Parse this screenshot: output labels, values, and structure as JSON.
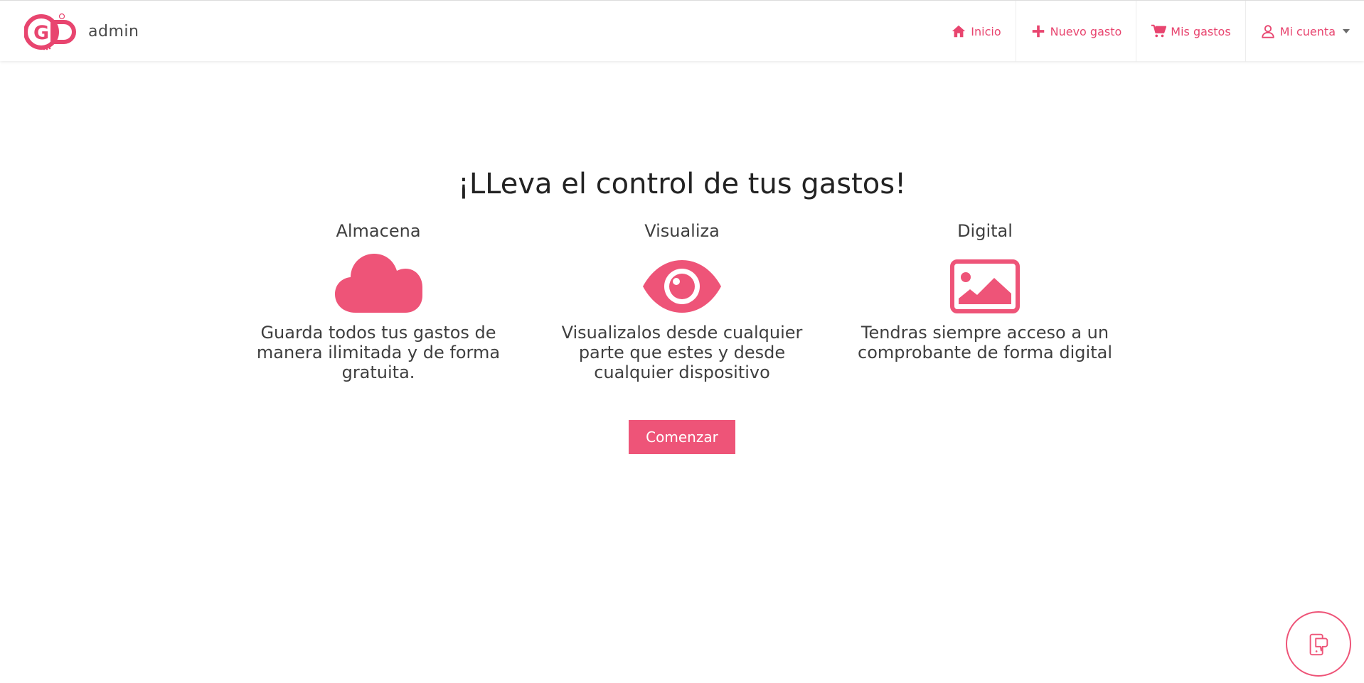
{
  "navbar": {
    "brand_text": "admin",
    "logo_icon": "gd-logo-icon",
    "items": [
      {
        "label": "Inicio",
        "icon": "home-icon"
      },
      {
        "label": "Nuevo gasto",
        "icon": "plus-icon"
      },
      {
        "label": "Mis gastos",
        "icon": "cart-icon"
      },
      {
        "label": "Mi cuenta",
        "icon": "user-icon",
        "dropdown": true
      }
    ]
  },
  "hero": {
    "title": "¡LLeva el control de tus gastos!",
    "features": [
      {
        "title": "Almacena",
        "icon": "cloud-icon",
        "description": "Guarda todos tus gastos de manera ilimitada y de forma gratuita."
      },
      {
        "title": "Visualiza",
        "icon": "eye-icon",
        "description": "Visualizalos desde cualquier parte que estes y desde cualquier dispositivo"
      },
      {
        "title": "Digital",
        "icon": "image-icon",
        "description": "Tendras siempre acceso a un comprobante de forma digital"
      }
    ],
    "cta_label": "Comenzar"
  },
  "floating_button": {
    "icon": "mobile-hand-icon"
  },
  "colors": {
    "accent": "#ee5478",
    "text": "#3f3f3f",
    "background": "#ffffff"
  }
}
